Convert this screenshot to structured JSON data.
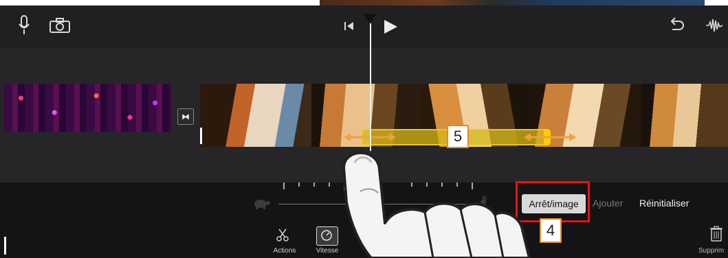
{
  "toolbar": {
    "icons": [
      "mic-icon",
      "camera-icon",
      "skip-back-icon",
      "play-icon",
      "undo-icon",
      "audio-waveform-icon"
    ]
  },
  "timeline": {
    "transition_icon": "⧓",
    "selection_color": "#e8c823"
  },
  "speed_panel": {
    "freeze_frame_label": "Arrêt/image",
    "add_label": "Ajouter",
    "reset_label": "Réinitialiser",
    "slow_icon": "turtle-icon",
    "fast_icon": "rabbit-icon"
  },
  "bottom_tools": {
    "actions_label": "Actions",
    "speed_label": "Vitesse",
    "delete_label": "Supprim"
  },
  "callouts": {
    "step_4": "4",
    "step_5": "5"
  },
  "colors": {
    "highlight_box": "#e11111",
    "callout_border": "#e58a2a",
    "app_background": "#1d1d1f"
  }
}
